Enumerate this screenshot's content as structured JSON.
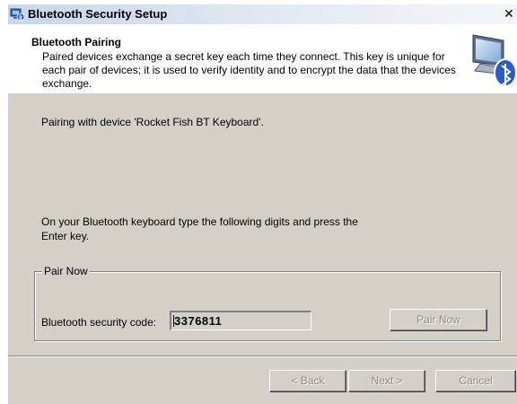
{
  "window": {
    "title": "Bluetooth Security Setup",
    "close_glyph": "✕"
  },
  "header": {
    "title": "Bluetooth Pairing",
    "description": "Paired devices exchange a secret key each time they connect. This key is unique for each pair of devices; it is used to verify identity and to encrypt the data that the devices exchange.",
    "graphic_icon": "computer-bluetooth-icon"
  },
  "body": {
    "pairing_text": "Pairing with device 'Rocket Fish BT Keyboard'.",
    "instruction_text": "On your Bluetooth keyboard type the following digits and press the Enter key."
  },
  "pair_now": {
    "legend": "Pair Now",
    "code_label": "Bluetooth security code:",
    "code_value": "3376811",
    "pair_button": "Pair Now"
  },
  "footer": {
    "back_label": "< Back",
    "next_label": "Next >",
    "cancel_label": "Cancel"
  },
  "colors": {
    "dialog_bg": "#d4d0c8",
    "disabled_text": "#8d8a84"
  }
}
